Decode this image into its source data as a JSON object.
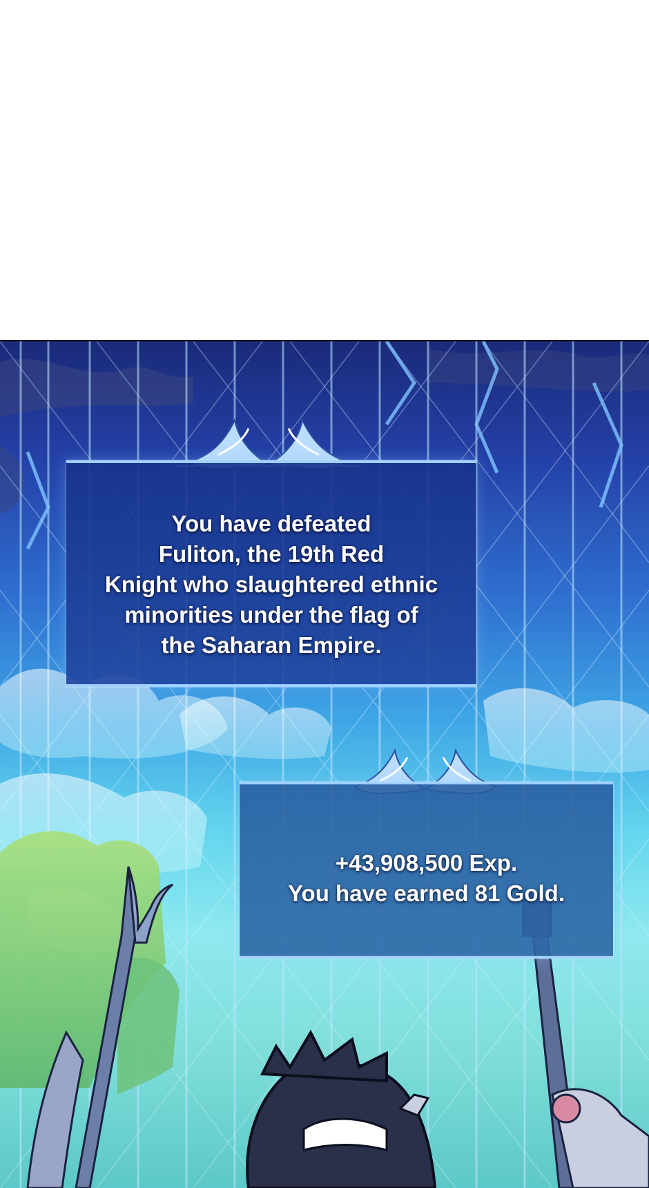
{
  "panel_top": {
    "description_colors": {
      "background": "#ffffff"
    }
  },
  "notification_1": {
    "lines": [
      "You have defeated",
      "Fuliton, the 19th Red",
      "Knight who slaughtered ethnic",
      "minorities under the flag of",
      "the Saharan Empire."
    ]
  },
  "notification_2": {
    "lines": [
      "+43,908,500 Exp.",
      "You have earned 81 Gold."
    ]
  },
  "colors": {
    "sky_top": "#1b2a7a",
    "sky_bottom": "#5cc8c7",
    "box_border": "#9fd0ff",
    "text": "#ffffff"
  },
  "icons": [
    "wave-ornament-icon",
    "spear-icon",
    "sword-icon"
  ]
}
